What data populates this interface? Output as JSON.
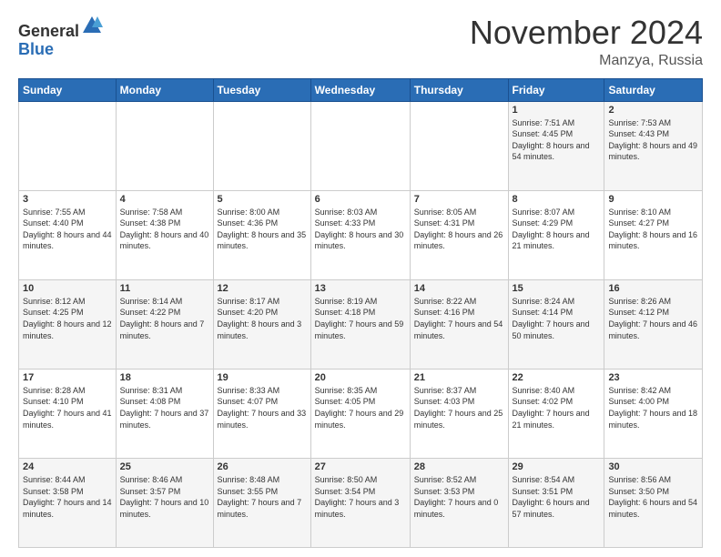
{
  "logo": {
    "general": "General",
    "blue": "Blue"
  },
  "header": {
    "month": "November 2024",
    "location": "Manzya, Russia"
  },
  "weekdays": [
    "Sunday",
    "Monday",
    "Tuesday",
    "Wednesday",
    "Thursday",
    "Friday",
    "Saturday"
  ],
  "weeks": [
    [
      {
        "day": "",
        "info": ""
      },
      {
        "day": "",
        "info": ""
      },
      {
        "day": "",
        "info": ""
      },
      {
        "day": "",
        "info": ""
      },
      {
        "day": "",
        "info": ""
      },
      {
        "day": "1",
        "info": "Sunrise: 7:51 AM\nSunset: 4:45 PM\nDaylight: 8 hours and 54 minutes."
      },
      {
        "day": "2",
        "info": "Sunrise: 7:53 AM\nSunset: 4:43 PM\nDaylight: 8 hours and 49 minutes."
      }
    ],
    [
      {
        "day": "3",
        "info": "Sunrise: 7:55 AM\nSunset: 4:40 PM\nDaylight: 8 hours and 44 minutes."
      },
      {
        "day": "4",
        "info": "Sunrise: 7:58 AM\nSunset: 4:38 PM\nDaylight: 8 hours and 40 minutes."
      },
      {
        "day": "5",
        "info": "Sunrise: 8:00 AM\nSunset: 4:36 PM\nDaylight: 8 hours and 35 minutes."
      },
      {
        "day": "6",
        "info": "Sunrise: 8:03 AM\nSunset: 4:33 PM\nDaylight: 8 hours and 30 minutes."
      },
      {
        "day": "7",
        "info": "Sunrise: 8:05 AM\nSunset: 4:31 PM\nDaylight: 8 hours and 26 minutes."
      },
      {
        "day": "8",
        "info": "Sunrise: 8:07 AM\nSunset: 4:29 PM\nDaylight: 8 hours and 21 minutes."
      },
      {
        "day": "9",
        "info": "Sunrise: 8:10 AM\nSunset: 4:27 PM\nDaylight: 8 hours and 16 minutes."
      }
    ],
    [
      {
        "day": "10",
        "info": "Sunrise: 8:12 AM\nSunset: 4:25 PM\nDaylight: 8 hours and 12 minutes."
      },
      {
        "day": "11",
        "info": "Sunrise: 8:14 AM\nSunset: 4:22 PM\nDaylight: 8 hours and 7 minutes."
      },
      {
        "day": "12",
        "info": "Sunrise: 8:17 AM\nSunset: 4:20 PM\nDaylight: 8 hours and 3 minutes."
      },
      {
        "day": "13",
        "info": "Sunrise: 8:19 AM\nSunset: 4:18 PM\nDaylight: 7 hours and 59 minutes."
      },
      {
        "day": "14",
        "info": "Sunrise: 8:22 AM\nSunset: 4:16 PM\nDaylight: 7 hours and 54 minutes."
      },
      {
        "day": "15",
        "info": "Sunrise: 8:24 AM\nSunset: 4:14 PM\nDaylight: 7 hours and 50 minutes."
      },
      {
        "day": "16",
        "info": "Sunrise: 8:26 AM\nSunset: 4:12 PM\nDaylight: 7 hours and 46 minutes."
      }
    ],
    [
      {
        "day": "17",
        "info": "Sunrise: 8:28 AM\nSunset: 4:10 PM\nDaylight: 7 hours and 41 minutes."
      },
      {
        "day": "18",
        "info": "Sunrise: 8:31 AM\nSunset: 4:08 PM\nDaylight: 7 hours and 37 minutes."
      },
      {
        "day": "19",
        "info": "Sunrise: 8:33 AM\nSunset: 4:07 PM\nDaylight: 7 hours and 33 minutes."
      },
      {
        "day": "20",
        "info": "Sunrise: 8:35 AM\nSunset: 4:05 PM\nDaylight: 7 hours and 29 minutes."
      },
      {
        "day": "21",
        "info": "Sunrise: 8:37 AM\nSunset: 4:03 PM\nDaylight: 7 hours and 25 minutes."
      },
      {
        "day": "22",
        "info": "Sunrise: 8:40 AM\nSunset: 4:02 PM\nDaylight: 7 hours and 21 minutes."
      },
      {
        "day": "23",
        "info": "Sunrise: 8:42 AM\nSunset: 4:00 PM\nDaylight: 7 hours and 18 minutes."
      }
    ],
    [
      {
        "day": "24",
        "info": "Sunrise: 8:44 AM\nSunset: 3:58 PM\nDaylight: 7 hours and 14 minutes."
      },
      {
        "day": "25",
        "info": "Sunrise: 8:46 AM\nSunset: 3:57 PM\nDaylight: 7 hours and 10 minutes."
      },
      {
        "day": "26",
        "info": "Sunrise: 8:48 AM\nSunset: 3:55 PM\nDaylight: 7 hours and 7 minutes."
      },
      {
        "day": "27",
        "info": "Sunrise: 8:50 AM\nSunset: 3:54 PM\nDaylight: 7 hours and 3 minutes."
      },
      {
        "day": "28",
        "info": "Sunrise: 8:52 AM\nSunset: 3:53 PM\nDaylight: 7 hours and 0 minutes."
      },
      {
        "day": "29",
        "info": "Sunrise: 8:54 AM\nSunset: 3:51 PM\nDaylight: 6 hours and 57 minutes."
      },
      {
        "day": "30",
        "info": "Sunrise: 8:56 AM\nSunset: 3:50 PM\nDaylight: 6 hours and 54 minutes."
      }
    ]
  ]
}
